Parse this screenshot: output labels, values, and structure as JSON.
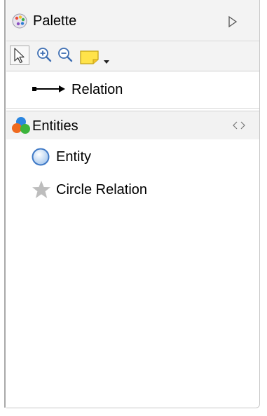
{
  "palette": {
    "title": "Palette",
    "tools": {
      "select": "select-tool",
      "zoom_in": "zoom-in-tool",
      "zoom_out": "zoom-out-tool",
      "note": "note-tool"
    },
    "connections": [
      {
        "label": "Relation",
        "icon": "arrow-connection-icon"
      }
    ],
    "drawers": [
      {
        "label": "Entities",
        "icon": "entities-icon",
        "items": [
          {
            "label": "Entity",
            "icon": "circle-entity-icon"
          },
          {
            "label": "Circle Relation",
            "icon": "star-icon"
          }
        ]
      }
    ]
  },
  "colors": {
    "header_bg": "#f3f3f3",
    "border": "#cfcfcf",
    "accent": "#4a90d9"
  }
}
